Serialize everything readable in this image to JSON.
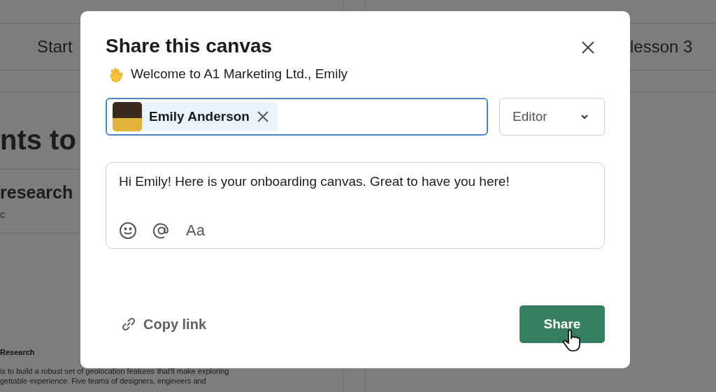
{
  "background": {
    "left_tab": "Start",
    "right_tab": "lesson 3",
    "heading": "nts to",
    "section_title": "research",
    "section_meta": "c",
    "doc_title": "Research",
    "doc_lines": [
      "is to build a robust set of geolocation features that'll make exploring",
      "gettable experience. Five teams of designers, engineers and"
    ]
  },
  "dialog": {
    "title": "Share this canvas",
    "subtitle": "Welcome to A1 Marketing Ltd., Emily",
    "recipient_field": {
      "focused": true,
      "chips": [
        {
          "name": "Emily Anderson"
        }
      ]
    },
    "role_select": {
      "value": "Editor"
    },
    "message": {
      "value": "Hi Emily! Here is your onboarding canvas. Great to have you here!",
      "tools": [
        {
          "kind": "emoji"
        },
        {
          "kind": "mention"
        },
        {
          "kind": "format",
          "label": "Aa"
        }
      ]
    },
    "copy_link": "Copy link",
    "share_button": "Share"
  }
}
